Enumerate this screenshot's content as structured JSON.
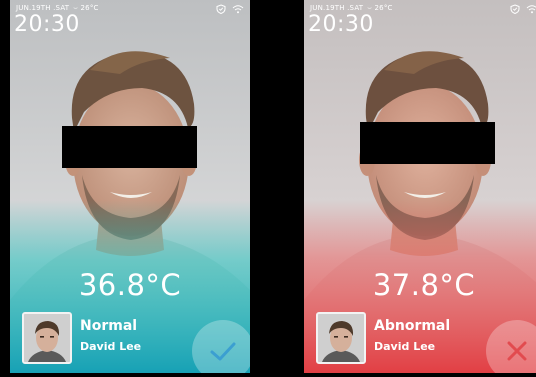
{
  "screens": [
    {
      "status_bar": {
        "date": "JUN.19TH .SAT",
        "weather": "26°C",
        "time": "20:30"
      },
      "temperature": "36.8°C",
      "status": "Normal",
      "person_name": "David Lee",
      "result_icon": "checkmark-icon",
      "theme": {
        "top": "#cfd0d2",
        "accent": "#1fc2c0",
        "bottom": "#19a6b6"
      }
    },
    {
      "status_bar": {
        "date": "JUN.19TH .SAT",
        "weather": "26°C",
        "time": "20:30"
      },
      "temperature": "37.8°C",
      "status": "Abnormal",
      "person_name": "David Lee",
      "result_icon": "close-x-icon",
      "theme": {
        "top": "#d6cfcf",
        "accent": "#ef5f5f",
        "bottom": "#e23f44"
      }
    }
  ]
}
